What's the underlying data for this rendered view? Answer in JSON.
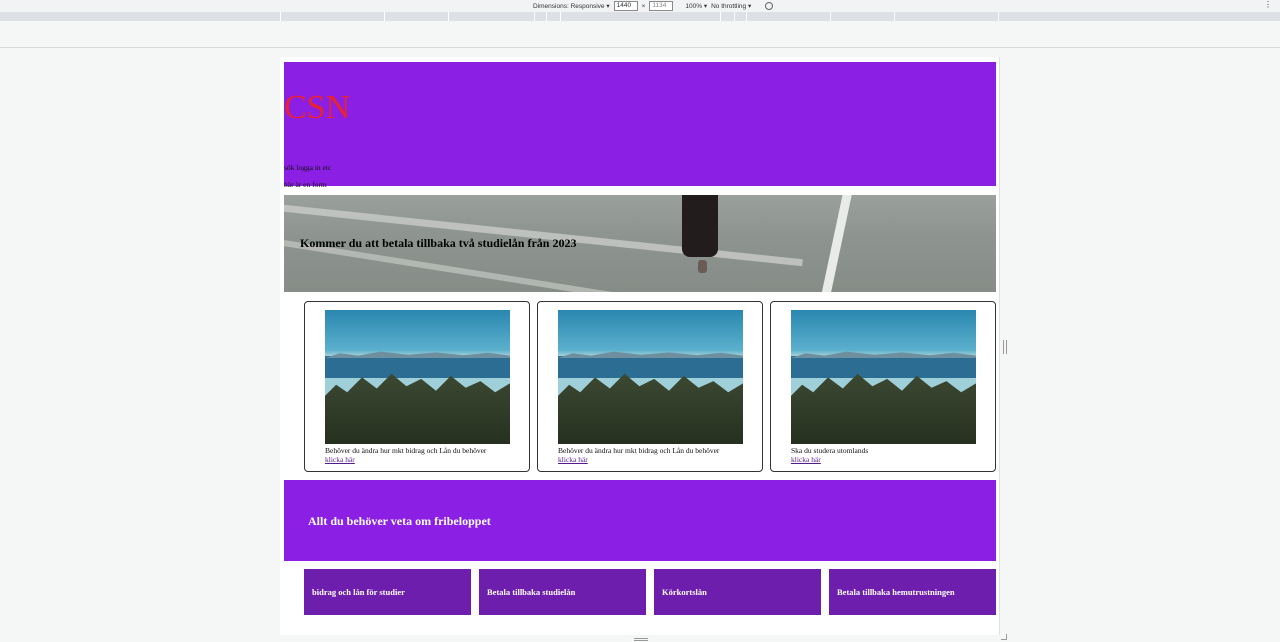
{
  "devtools": {
    "dimensions_label": "Dimensions: Responsive ▾",
    "width_value": "1440",
    "x_sep": "×",
    "height_placeholder": "1134",
    "zoom": "100% ▾",
    "throttling": "No throttling ▾",
    "more": "⋮"
  },
  "header": {
    "logo": "CSN",
    "line1": "sök logga in etc",
    "line2": "här är en form"
  },
  "hero": {
    "heading": "Kommer du att betala tillbaka två studielån från 2023"
  },
  "cards": [
    {
      "text": "Behöver du ändra hur mkt bidrag och Lån du behöver",
      "link": "klicka här"
    },
    {
      "text": "Behöver du ändra hur mkt bidrag och Lån du behöver",
      "link": "klicka här"
    },
    {
      "text": "Ska du studera utomlands",
      "link": "klicka här"
    }
  ],
  "banner": {
    "heading": "Allt du behöver veta om fribeloppet"
  },
  "tiles": [
    {
      "label": "bidrag och lån för studier"
    },
    {
      "label": "Betala tillbaka studielån"
    },
    {
      "label": "Körkortslån"
    },
    {
      "label": "Betala tillbaka hemutrustningen"
    }
  ],
  "colors": {
    "header_purple": "#8b1fe4",
    "tile_purple": "#6d1ead",
    "logo_red": "#e8232f"
  }
}
